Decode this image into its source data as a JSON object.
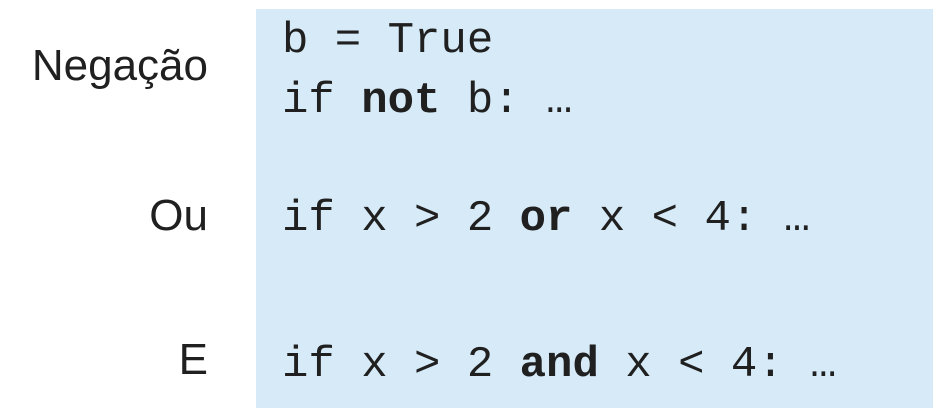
{
  "labels": {
    "negation": "Negação",
    "or": "Ou",
    "and": "E"
  },
  "code": {
    "assign": {
      "text": "b = True"
    },
    "not_line": {
      "before": "if ",
      "keyword": "not",
      "after": " b: …"
    },
    "or_line": {
      "before": "if x > 2 ",
      "keyword": "or",
      "after": " x < 4: …"
    },
    "and_line": {
      "before": "if x > 2 ",
      "keyword": "and",
      "after": " x < 4: …"
    }
  },
  "colors": {
    "code_background": "#d6eaf8",
    "text": "#202020"
  }
}
